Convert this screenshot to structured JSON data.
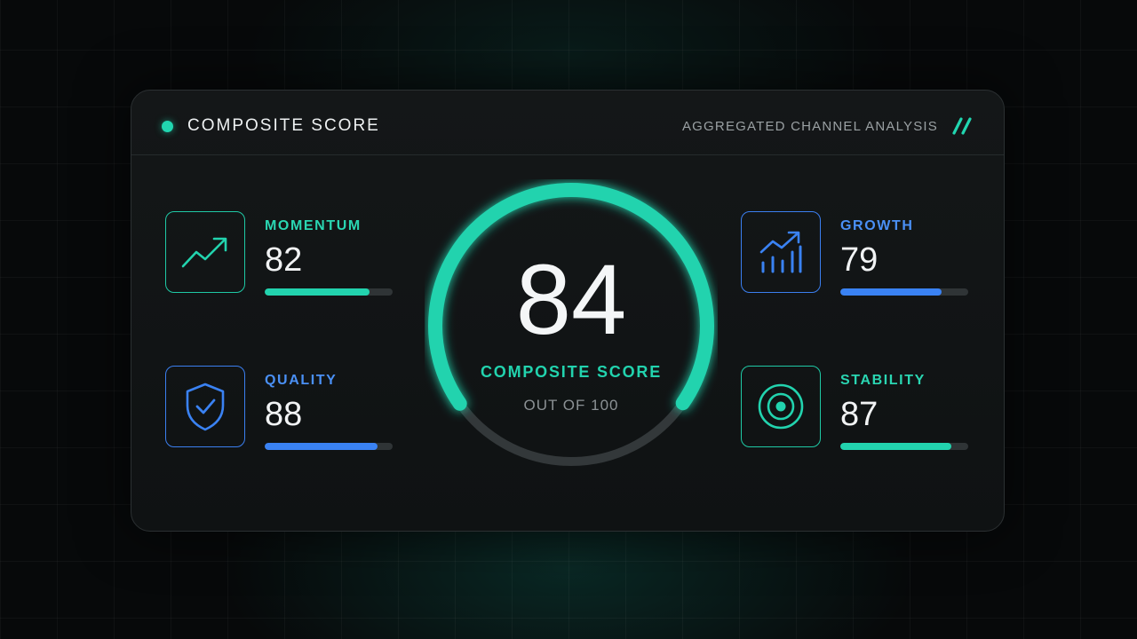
{
  "header": {
    "title": "COMPOSITE SCORE",
    "subtitle": "AGGREGATED CHANNEL ANALYSIS",
    "status_color": "#21d6b0",
    "slash_icon": "double-slash-icon"
  },
  "gauge": {
    "value": "84",
    "label": "COMPOSITE SCORE",
    "sub": "OUT OF 100",
    "score": 84,
    "max": 100,
    "accent_color": "#22d3ae",
    "track_color": "#33383a"
  },
  "metrics": [
    {
      "label": "MOMENTUM",
      "value": "82",
      "score": 82,
      "icon": "trend-up-icon",
      "color": "#22d3ae"
    },
    {
      "label": "QUALITY",
      "value": "88",
      "score": 88,
      "icon": "shield-check-icon",
      "color": "#3a82f3"
    },
    {
      "label": "GROWTH",
      "value": "79",
      "score": 79,
      "icon": "bar-chart-growth-icon",
      "color": "#3a82f3"
    },
    {
      "label": "STABILITY",
      "value": "87",
      "score": 87,
      "icon": "target-icon",
      "color": "#22d3ae"
    }
  ]
}
